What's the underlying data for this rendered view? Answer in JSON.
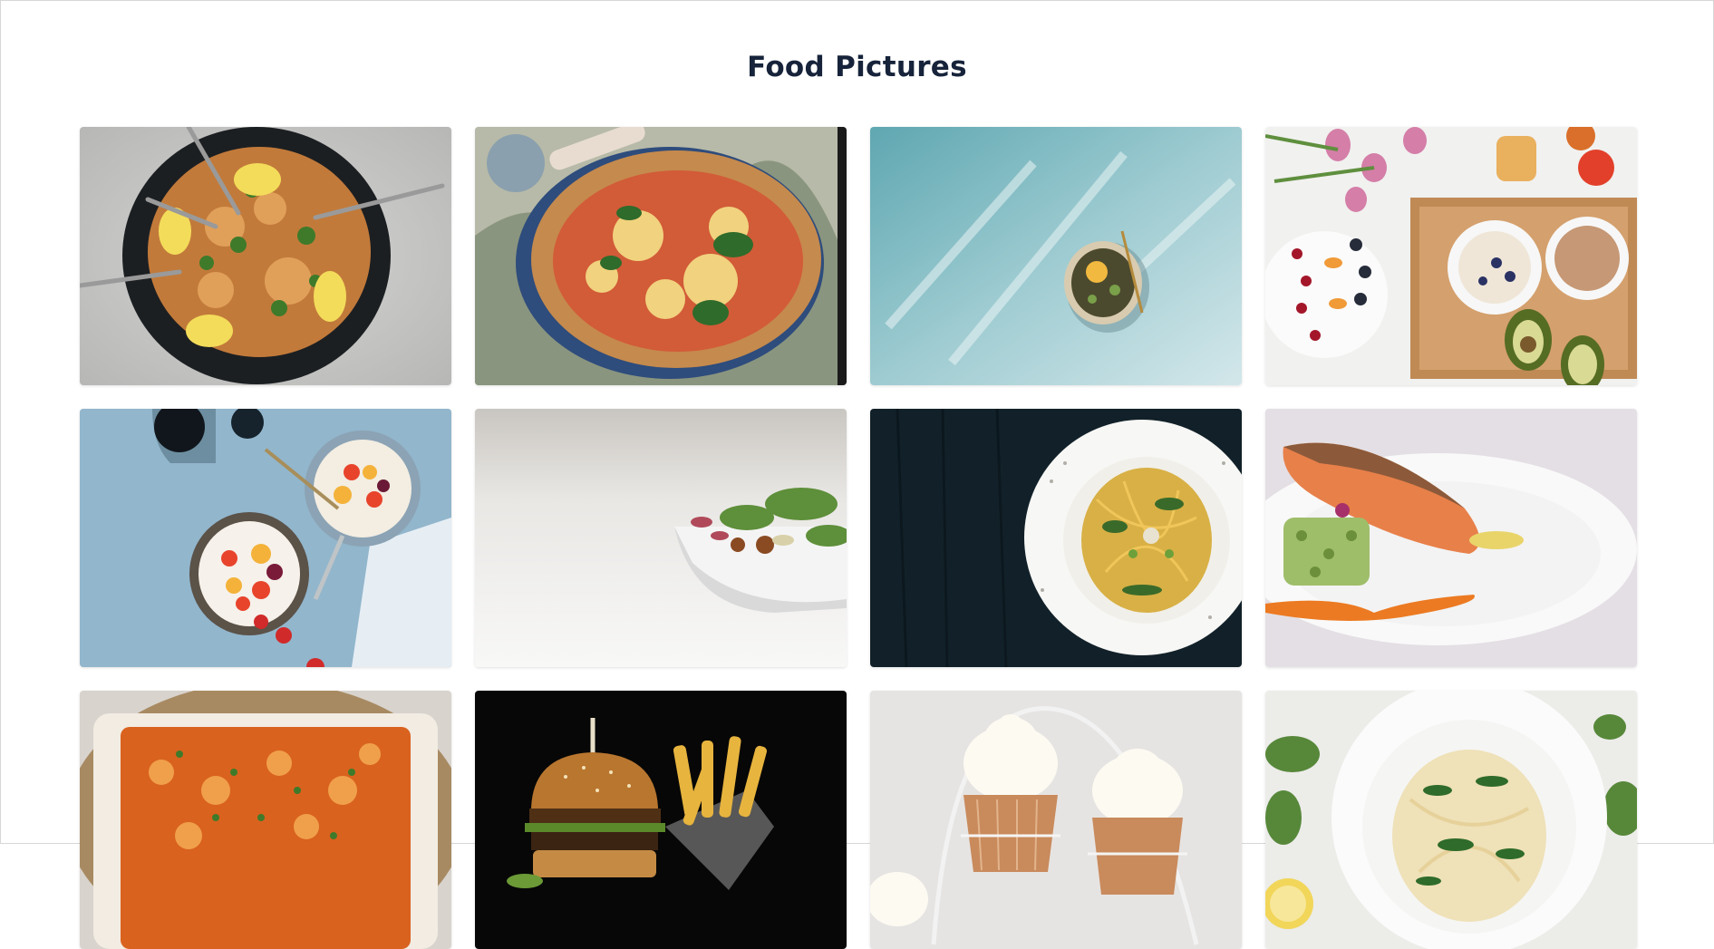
{
  "page": {
    "title": "Food Pictures"
  },
  "gallery": {
    "items": [
      {
        "name": "paella-skillet"
      },
      {
        "name": "margherita-pizza"
      },
      {
        "name": "plate-on-teal-painted-background"
      },
      {
        "name": "breakfast-spread-with-fruit-and-avocado"
      },
      {
        "name": "fruit-yogurt-bowls"
      },
      {
        "name": "salad-bowl-on-white"
      },
      {
        "name": "spaghetti-plate-on-dark-wood"
      },
      {
        "name": "salmon-fillet-plate"
      },
      {
        "name": "baked-pasta-casserole"
      },
      {
        "name": "burger-and-fries"
      },
      {
        "name": "cupcakes-on-stand"
      },
      {
        "name": "pasta-with-greens"
      }
    ]
  }
}
